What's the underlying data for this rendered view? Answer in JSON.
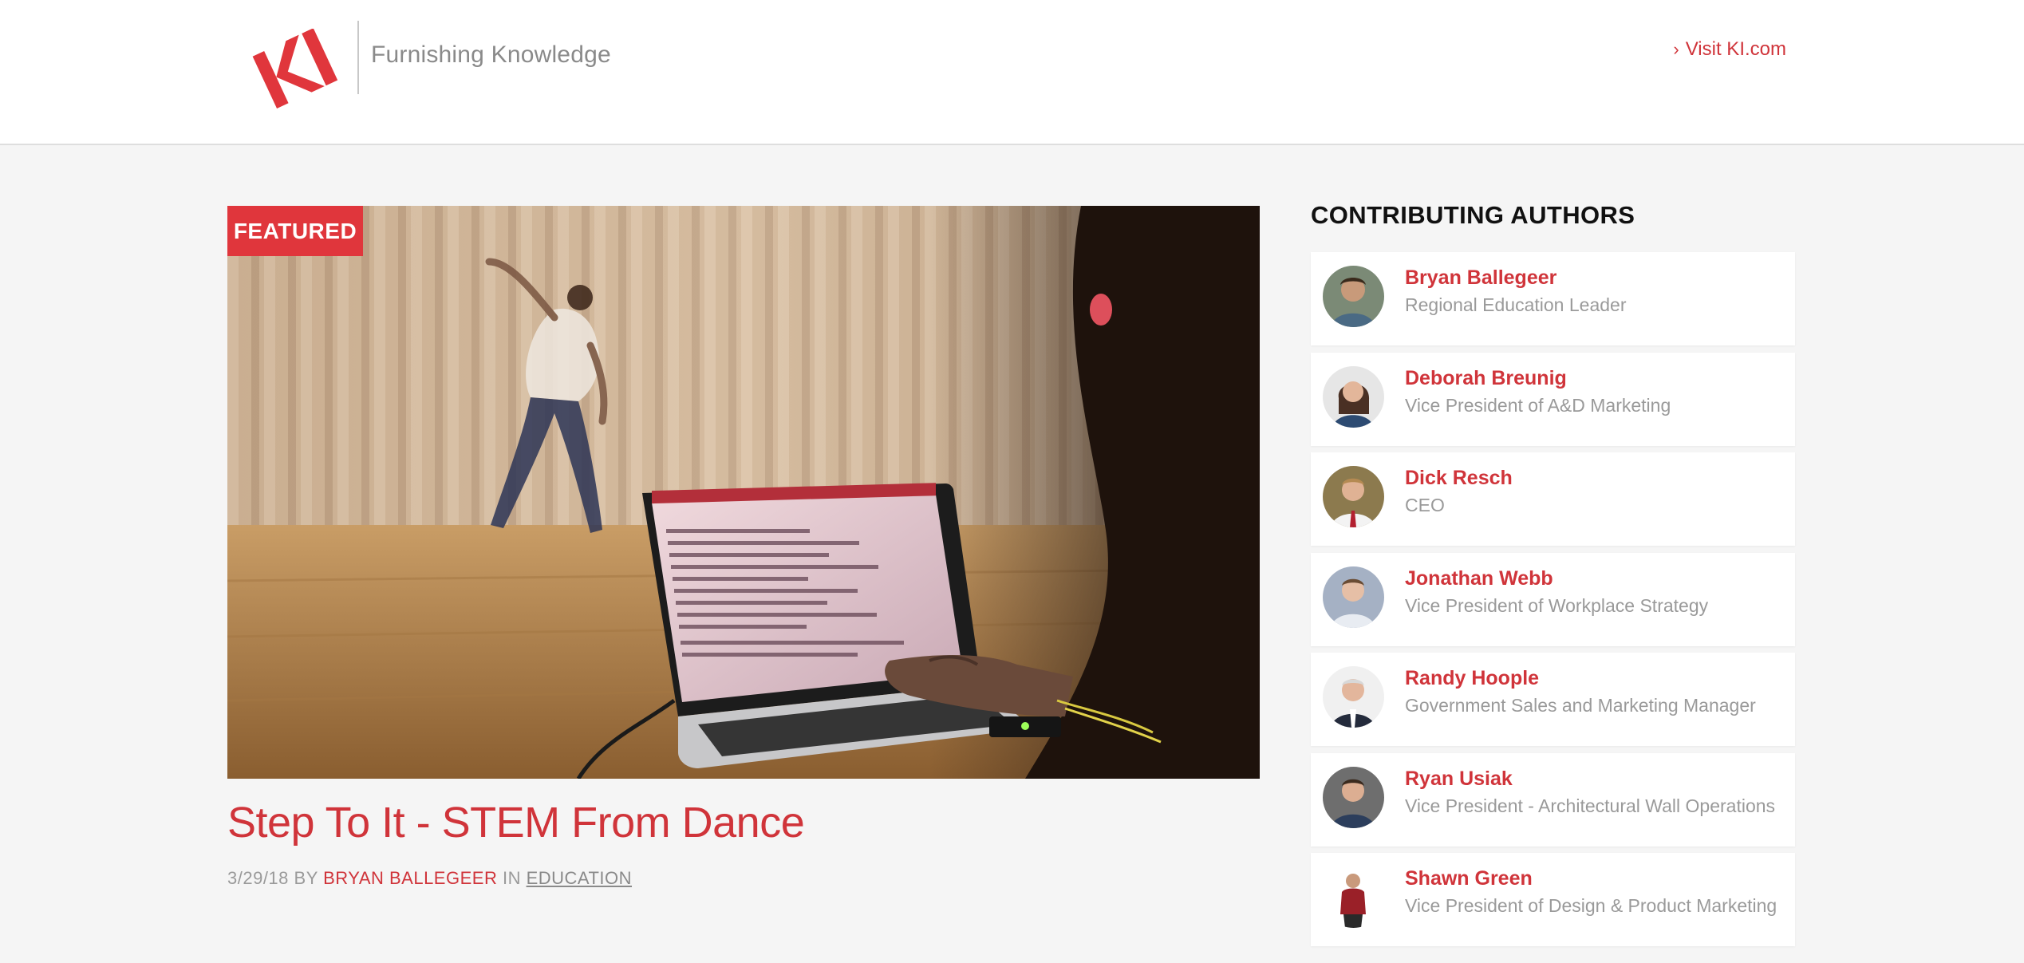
{
  "header": {
    "logo_text": "KI",
    "tagline": "Furnishing Knowledge",
    "visit_link": "Visit KI.com"
  },
  "featured": {
    "badge": "FEATURED",
    "title": "Step To It - STEM From Dance",
    "date": "3/29/18",
    "by_label": "BY",
    "author": "BRYAN BALLEGEER",
    "in_label": "IN",
    "category": "EDUCATION"
  },
  "authors": {
    "heading": "CONTRIBUTING AUTHORS",
    "items": [
      {
        "name": "Bryan Ballegeer",
        "role": "Regional Education Leader"
      },
      {
        "name": "Deborah Breunig",
        "role": "Vice President of A&D Marketing"
      },
      {
        "name": "Dick Resch",
        "role": "CEO"
      },
      {
        "name": "Jonathan Webb",
        "role": "Vice President of Workplace Strategy"
      },
      {
        "name": "Randy Hoople",
        "role": "Government Sales and Marketing Manager"
      },
      {
        "name": "Ryan Usiak",
        "role": "Vice President - Architectural Wall Operations"
      },
      {
        "name": "Shawn Green",
        "role": "Vice President of Design & Product Marketing"
      }
    ]
  },
  "colors": {
    "brand_red": "#d0343a",
    "badge_red": "#e0363c",
    "background": "#f5f5f5"
  }
}
